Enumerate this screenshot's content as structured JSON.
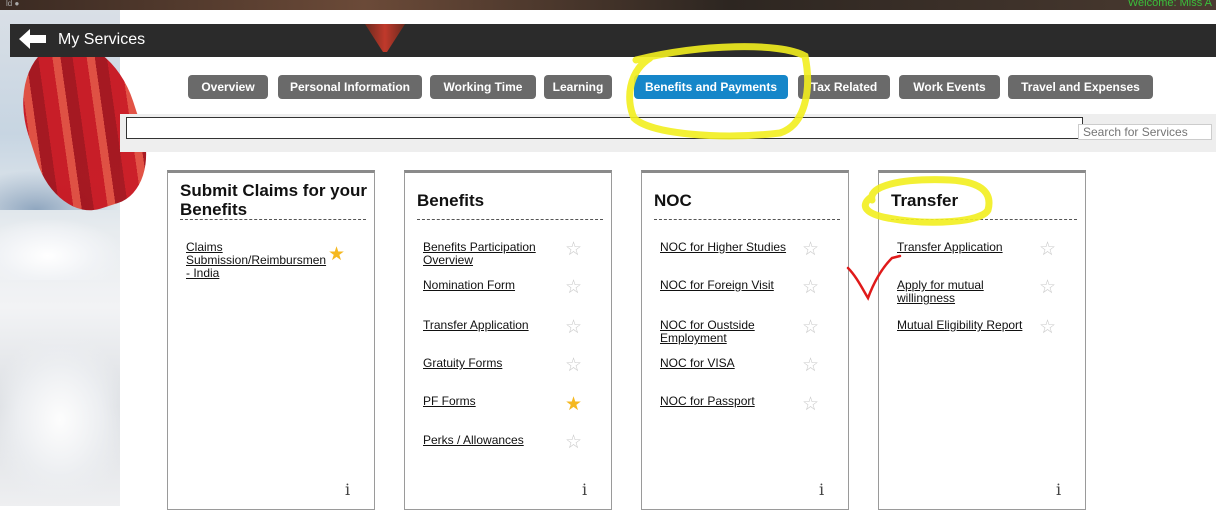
{
  "window": {
    "welcome": "Welcome: Miss A",
    "corner_text": "ld ●"
  },
  "header": {
    "title": "My Services",
    "back_icon": "arrow-left-icon"
  },
  "tabs": [
    {
      "label": "Overview",
      "active": false
    },
    {
      "label": "Personal Information",
      "active": false
    },
    {
      "label": "Working Time",
      "active": false
    },
    {
      "label": "Learning",
      "active": false
    },
    {
      "label": "Benefits and Payments",
      "active": true
    },
    {
      "label": "Tax Related",
      "active": false
    },
    {
      "label": "Work Events",
      "active": false
    },
    {
      "label": "Travel and Expenses",
      "active": false
    }
  ],
  "search": {
    "placeholder": "Search for Services",
    "value": ""
  },
  "colors": {
    "accent": "#1586c9",
    "tab": "#6a6a6a",
    "star_fav": "#f5b820",
    "highlight": "#f2ee1e",
    "annotation": "#e01a1a"
  },
  "cards": [
    {
      "title": "Submit Claims for your Benefits",
      "items": [
        {
          "label": "Claims Submission/Reimbursmen - India",
          "favorite": true
        }
      ],
      "info": "i"
    },
    {
      "title": "Benefits",
      "items": [
        {
          "label": "Benefits Participation Overview",
          "favorite": false
        },
        {
          "label": "Nomination Form",
          "favorite": false
        },
        {
          "label": "Transfer Application",
          "favorite": false
        },
        {
          "label": "Gratuity Forms",
          "favorite": false
        },
        {
          "label": "PF Forms",
          "favorite": true
        },
        {
          "label": "Perks / Allowances",
          "favorite": false
        }
      ],
      "info": "i"
    },
    {
      "title": "NOC",
      "items": [
        {
          "label": "NOC for Higher Studies",
          "favorite": false
        },
        {
          "label": "NOC for Foreign Visit",
          "favorite": false
        },
        {
          "label": "NOC for Oustside Employment",
          "favorite": false
        },
        {
          "label": "NOC for VISA",
          "favorite": false
        },
        {
          "label": "NOC for Passport",
          "favorite": false
        }
      ],
      "info": "i"
    },
    {
      "title": "Transfer",
      "items": [
        {
          "label": "Transfer Application",
          "favorite": false
        },
        {
          "label": "Apply for mutual willingness",
          "favorite": false
        },
        {
          "label": "Mutual Eligibility Report",
          "favorite": false
        }
      ],
      "info": "i"
    }
  ]
}
